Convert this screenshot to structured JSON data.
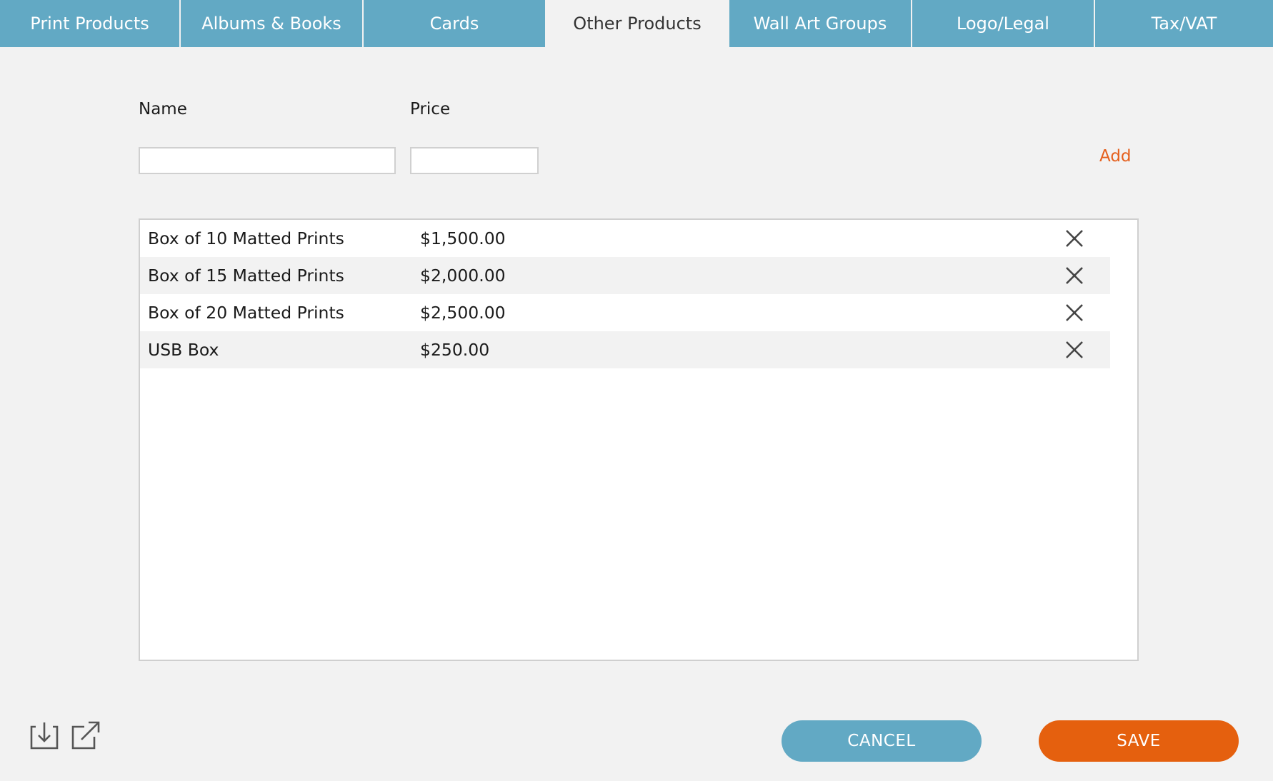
{
  "tabs": [
    {
      "label": "Print Products",
      "active": false
    },
    {
      "label": "Albums & Books",
      "active": false
    },
    {
      "label": "Cards",
      "active": false
    },
    {
      "label": "Other Products",
      "active": true
    },
    {
      "label": "Wall Art Groups",
      "active": false
    },
    {
      "label": "Logo/Legal",
      "active": false
    },
    {
      "label": "Tax/VAT",
      "active": false
    }
  ],
  "form": {
    "name_label": "Name",
    "price_label": "Price",
    "name_value": "",
    "price_value": "",
    "add_label": "Add"
  },
  "products": [
    {
      "name": "Box of 10 Matted Prints",
      "price": "$1,500.00",
      "remove_icon": "close-icon"
    },
    {
      "name": "Box of 15 Matted Prints",
      "price": "$2,000.00",
      "remove_icon": "close-icon"
    },
    {
      "name": "Box of 20 Matted Prints",
      "price": "$2,500.00",
      "remove_icon": "close-icon"
    },
    {
      "name": "USB Box",
      "price": "$250.00",
      "remove_icon": "close-icon"
    }
  ],
  "footer": {
    "icons": [
      "import-icon",
      "export-icon"
    ],
    "cancel_label": "CANCEL",
    "save_label": "SAVE"
  },
  "colors": {
    "tab_bg": "#62a9c4",
    "accent": "#e5601d",
    "save_bg": "#e5600e",
    "page_bg": "#f2f2f2"
  }
}
